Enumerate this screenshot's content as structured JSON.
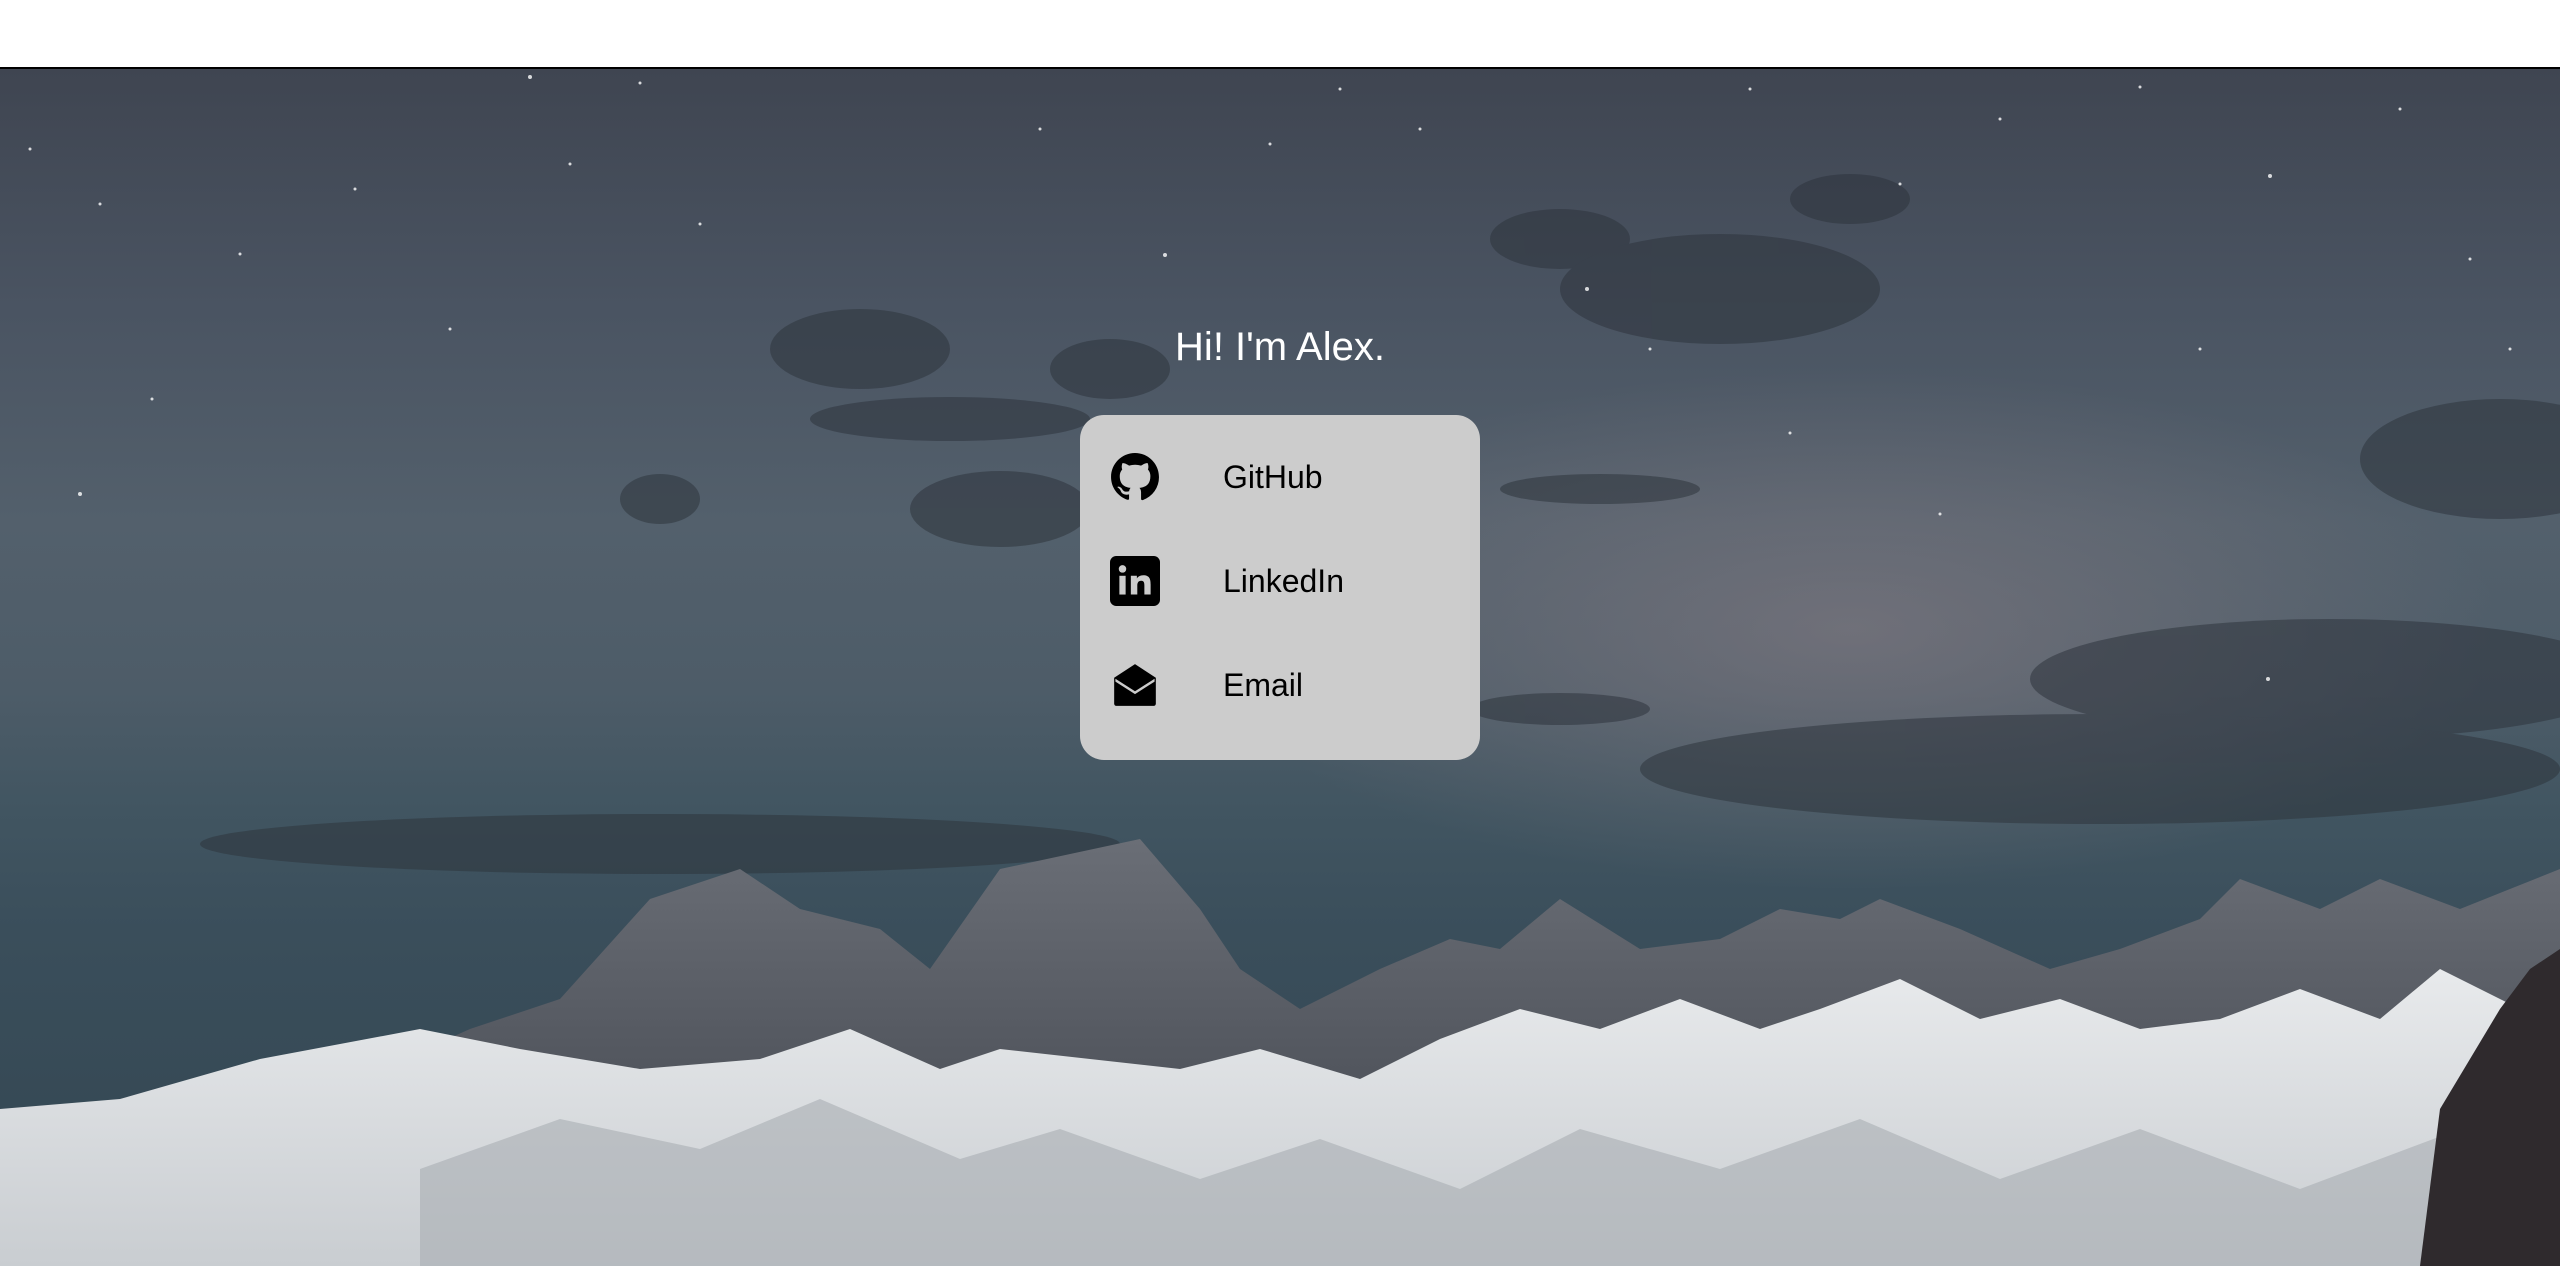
{
  "header": {},
  "hero": {
    "greeting": "Hi! I'm Alex."
  },
  "links": [
    {
      "label": "GitHub",
      "icon": "github-icon"
    },
    {
      "label": "LinkedIn",
      "icon": "linkedin-icon"
    },
    {
      "label": "Email",
      "icon": "envelope-open-icon"
    }
  ],
  "colors": {
    "card_background": "#cccccc",
    "greeting_text": "#ffffff",
    "link_text": "#000000"
  }
}
